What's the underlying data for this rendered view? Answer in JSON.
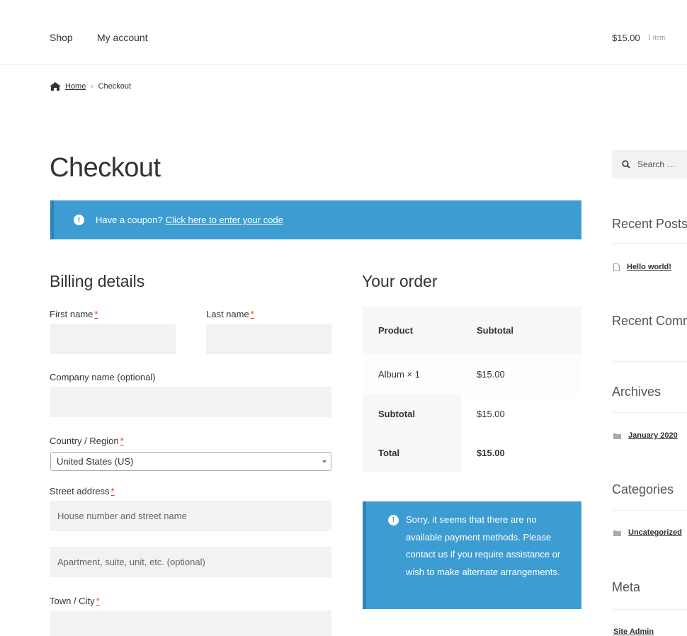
{
  "nav": {
    "shop": "Shop",
    "my_account": "My account"
  },
  "cart": {
    "total": "$15.00",
    "count": "1 item"
  },
  "breadcrumb": {
    "home": "Home",
    "sep": ">",
    "current": "Checkout"
  },
  "page_title": "Checkout",
  "coupon": {
    "text": "Have a coupon?",
    "link": "Click here to enter your code"
  },
  "billing": {
    "title": "Billing details",
    "first_name": "First name",
    "last_name": "Last name",
    "company": "Company name (optional)",
    "country_label": "Country / Region",
    "country_value": "United States (US)",
    "street_label": "Street address",
    "street_placeholder": "House number and street name",
    "apt_placeholder": "Apartment, suite, unit, etc. (optional)",
    "city_label": "Town / City",
    "required_mark": "*"
  },
  "order": {
    "title": "Your order",
    "col_product": "Product",
    "col_subtotal": "Subtotal",
    "item_name": "Album",
    "item_qty": "× 1",
    "item_price": "$15.00",
    "subtotal_label": "Subtotal",
    "subtotal_value": "$15.00",
    "total_label": "Total",
    "total_value": "$15.00"
  },
  "payment_notice": "Sorry, it seems that there are no available payment methods. Please contact us if you require assistance or wish to make alternate arrangements.",
  "sidebar": {
    "search_placeholder": "Search …",
    "recent_posts": "Recent Posts",
    "post_link": "Hello world!",
    "recent_comments": "Recent Comm",
    "archives": "Archives",
    "archive_link": "January 2020",
    "categories": "Categories",
    "category_link": "Uncategorized",
    "meta": "Meta",
    "meta_link": "Site Admin"
  },
  "colors": {
    "notice_blue": "#3d9cd2",
    "notice_border": "#2c84b8",
    "required_red": "#e2401c"
  }
}
